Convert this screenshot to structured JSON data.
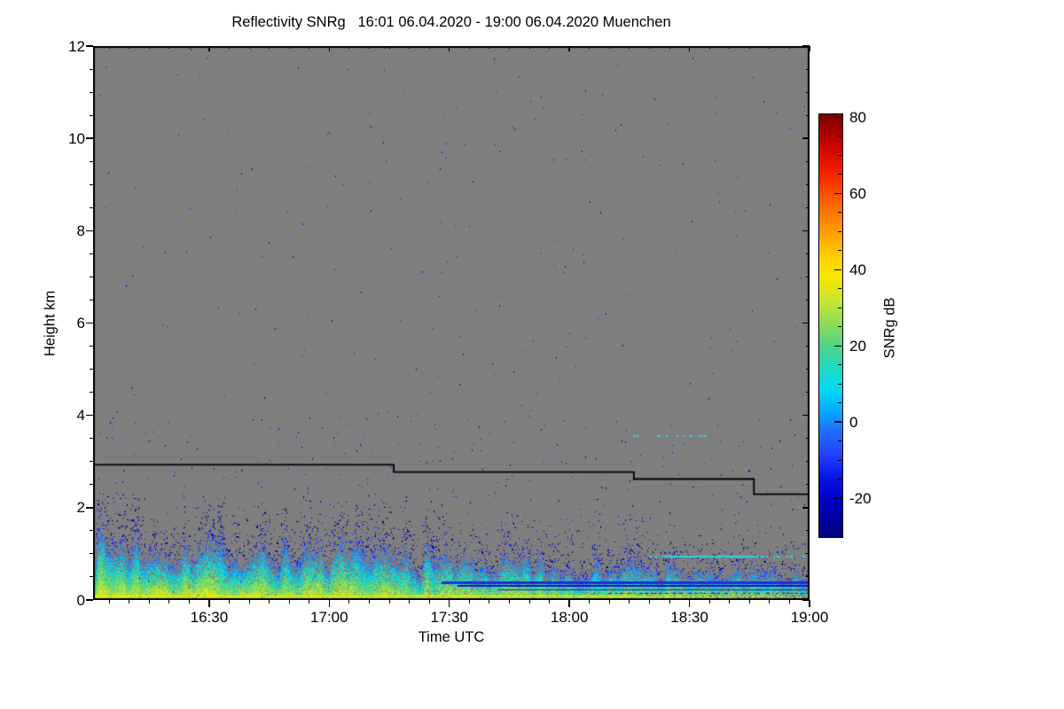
{
  "chart_data": {
    "type": "heatmap",
    "title": "Reflectivity SNRg   16:01 06.04.2020 - 19:00 06.04.2020 Muenchen",
    "xlabel": "Time UTC",
    "ylabel": "Height km",
    "x_range_min": [
      961,
      1140
    ],
    "x_ticks": [
      {
        "label": "16:30",
        "min": 990
      },
      {
        "label": "17:00",
        "min": 1020
      },
      {
        "label": "17:30",
        "min": 1050
      },
      {
        "label": "18:00",
        "min": 1080
      },
      {
        "label": "18:30",
        "min": 1110
      },
      {
        "label": "19:00",
        "min": 1140
      }
    ],
    "x_minor_step_min": 5,
    "y_range_km": [
      0,
      12
    ],
    "y_ticks": [
      0,
      2,
      4,
      6,
      8,
      10,
      12
    ],
    "y_minor_step_km": 0.5,
    "plot_bg": "#7e7e7e",
    "frame_color": "#000000",
    "grid": false,
    "colorbar": {
      "label": "SNRg dB",
      "range": [
        -30,
        81
      ],
      "ticks": [
        80,
        60,
        40,
        20,
        0,
        -20
      ],
      "minor_step": 5,
      "palette": [
        {
          "v": 81,
          "c": "#7a0000"
        },
        {
          "v": 74,
          "c": "#c00000"
        },
        {
          "v": 66,
          "c": "#f22000"
        },
        {
          "v": 58,
          "c": "#ff6000"
        },
        {
          "v": 50,
          "c": "#ff9e00"
        },
        {
          "v": 43,
          "c": "#ffd200"
        },
        {
          "v": 38,
          "c": "#f4e800"
        },
        {
          "v": 32,
          "c": "#c6e632"
        },
        {
          "v": 26,
          "c": "#8edc55"
        },
        {
          "v": 20,
          "c": "#4cd488"
        },
        {
          "v": 14,
          "c": "#1ed8c4"
        },
        {
          "v": 9,
          "c": "#00dcf0"
        },
        {
          "v": 3,
          "c": "#00aaff"
        },
        {
          "v": -2,
          "c": "#2070ff"
        },
        {
          "v": -8,
          "c": "#2244ff"
        },
        {
          "v": -14,
          "c": "#0a18e8"
        },
        {
          "v": -20,
          "c": "#0000c8"
        },
        {
          "v": -25,
          "c": "#0000a2"
        },
        {
          "v": -30,
          "c": "#000080"
        }
      ]
    },
    "first_gate_line": {
      "color": "#000000",
      "segments": [
        {
          "t0_min": 961,
          "t1_min": 1036,
          "h_km": 2.94
        },
        {
          "t0_min": 1036,
          "t1_min": 1096,
          "h_km": 2.78
        },
        {
          "t0_min": 1096,
          "t1_min": 1126,
          "h_km": 2.63
        },
        {
          "t0_min": 1126,
          "t1_min": 1140,
          "h_km": 2.3
        }
      ]
    },
    "streaks": [
      {
        "t0_min": 1096,
        "t1_min": 1116,
        "h_km": 3.55,
        "color": "#3cc8e8",
        "style": "dotted",
        "thick": 2
      },
      {
        "t0_min": 1104,
        "t1_min": 1127,
        "h_km": 0.94,
        "color": "#2fd2e8",
        "style": "solid",
        "thick": 2
      },
      {
        "t0_min": 1100,
        "t1_min": 1140,
        "h_km": 0.94,
        "color": "#2fd2e8",
        "style": "dotted",
        "thick": 2
      },
      {
        "t0_min": 1048,
        "t1_min": 1140,
        "h_km": 0.38,
        "color": "#1b2ce0",
        "style": "solid",
        "thick": 3
      },
      {
        "t0_min": 1052,
        "t1_min": 1140,
        "h_km": 0.3,
        "color": "#0a14cc",
        "style": "solid",
        "thick": 2
      },
      {
        "t0_min": 1062,
        "t1_min": 1140,
        "h_km": 0.22,
        "color": "#1428c8",
        "style": "solid",
        "thick": 1
      },
      {
        "t0_min": 1085,
        "t1_min": 1140,
        "h_km": 0.14,
        "color": "#1428c8",
        "style": "dotted",
        "thick": 1
      }
    ],
    "noise_specks": {
      "seed": 42,
      "uniform_count": 330,
      "low_band_count": 300,
      "mid_band_count": 130,
      "colors": [
        "#0010d8",
        "#1c34ee",
        "#2a6cf0",
        "#30c8e8"
      ]
    },
    "surface_signal": {
      "seed": 7,
      "max_height_km": 2.3,
      "envelope_km_start": 1.1,
      "envelope_km_end": 0.55,
      "peak_db": 34,
      "yellow_layer_km": 0.1,
      "fade_db_over_time": 9
    }
  }
}
